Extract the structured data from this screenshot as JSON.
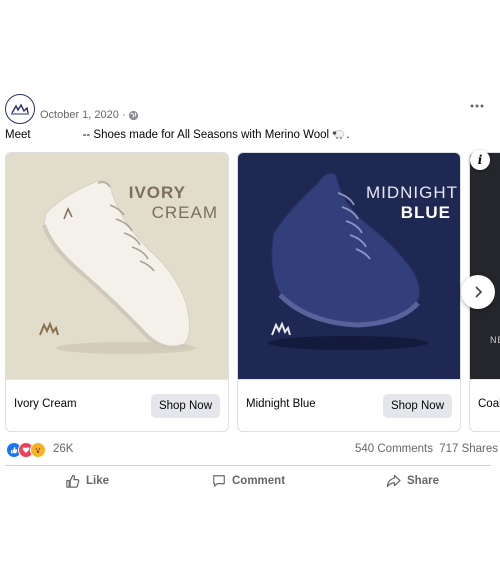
{
  "post": {
    "page_name": "",
    "date": "October 1, 2020 ·",
    "caption_start": "Meet",
    "caption_rest": "-- Shoes made for All Seasons with Merino Wool",
    "caption_end": "."
  },
  "carousel": {
    "cards": [
      {
        "img_line1": "IVORY",
        "img_line2": "CREAM",
        "title": "Ivory Cream",
        "cta": "Shop Now"
      },
      {
        "img_line1": "MIDNIGHT",
        "img_line2": "BLUE",
        "title": "Midnight Blue",
        "cta": "Shop Now"
      },
      {
        "img_line1": "NE",
        "title": "Coal"
      }
    ]
  },
  "stats": {
    "reaction_count": "26K",
    "comments": "540 Comments",
    "shares": "717 Shares"
  },
  "actions": {
    "like": "Like",
    "comment": "Comment",
    "share": "Share"
  },
  "colors": {
    "ivory_bg": "#e2dccb",
    "ivory_text": "#7d6d5f",
    "midnight_bg": "#1f2753",
    "like_blue": "#1877f2",
    "love_red": "#f33e58",
    "wow_yellow": "#f7b125",
    "secondary_text": "#65676b"
  }
}
